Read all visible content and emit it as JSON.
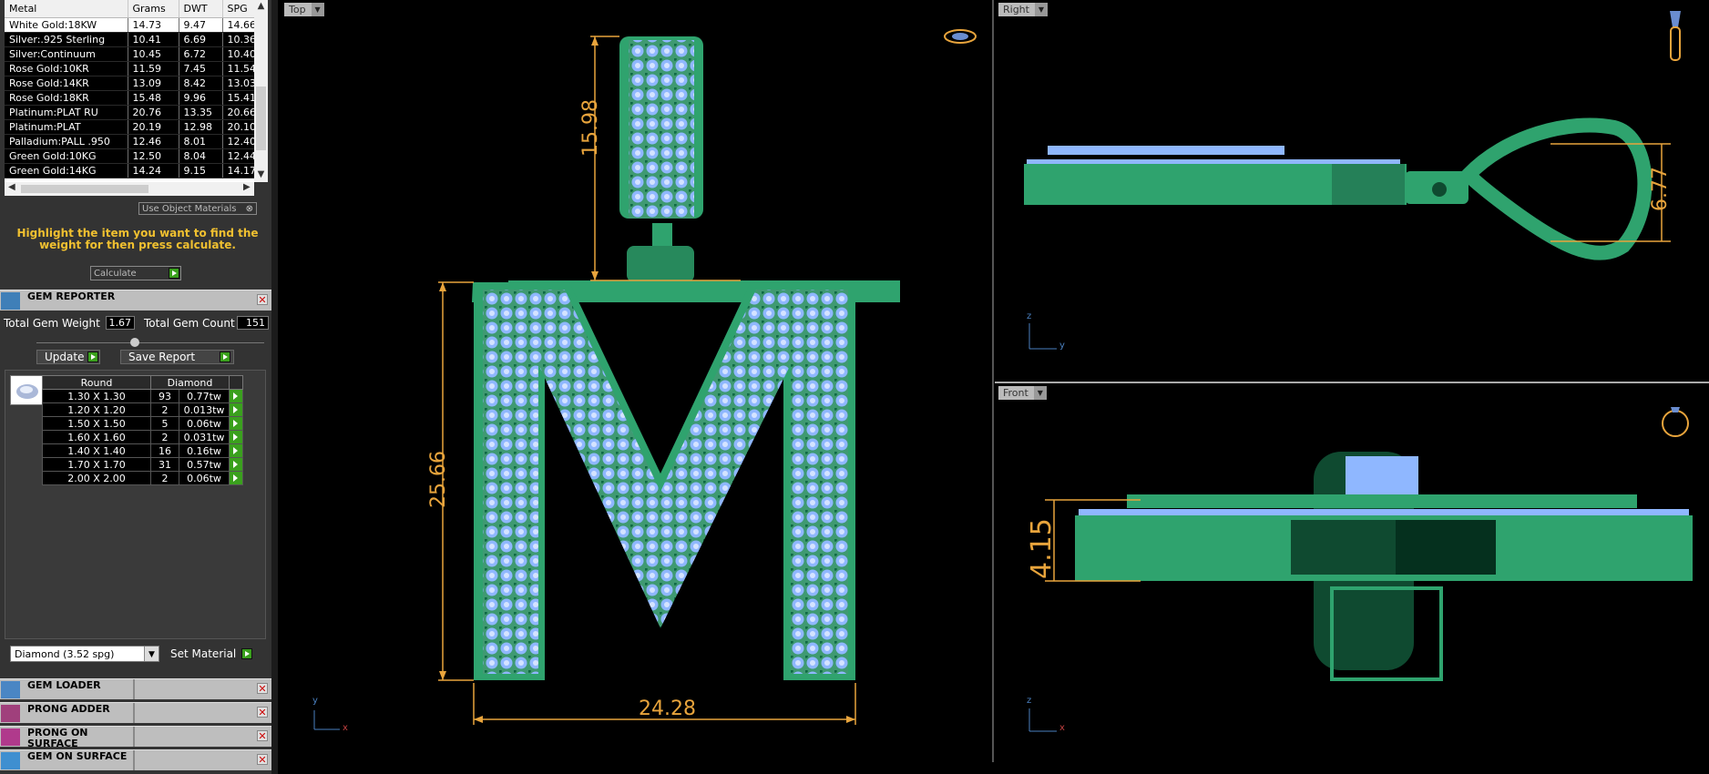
{
  "metal_table": {
    "columns": [
      "Metal",
      "Grams",
      "DWT",
      "SPG"
    ],
    "rows": [
      [
        "White Gold:18KW",
        "14.73",
        "9.47",
        "14.66"
      ],
      [
        "Silver:.925 Sterling",
        "10.41",
        "6.69",
        "10.36"
      ],
      [
        "Silver:Continuum",
        "10.45",
        "6.72",
        "10.40"
      ],
      [
        "Rose Gold:10KR",
        "11.59",
        "7.45",
        "11.54"
      ],
      [
        "Rose Gold:14KR",
        "13.09",
        "8.42",
        "13.03"
      ],
      [
        "Rose Gold:18KR",
        "15.48",
        "9.96",
        "15.41"
      ],
      [
        "Platinum:PLAT RU",
        "20.76",
        "13.35",
        "20.66"
      ],
      [
        "Platinum:PLAT",
        "20.19",
        "12.98",
        "20.10"
      ],
      [
        "Palladium:PALL .950",
        "12.46",
        "8.01",
        "12.40"
      ],
      [
        "Green Gold:10KG",
        "12.50",
        "8.04",
        "12.44"
      ],
      [
        "Green Gold:14KG",
        "14.24",
        "9.15",
        "14.17"
      ]
    ]
  },
  "use_object_materials": "Use Object Materials",
  "hint": "Highlight the item you want to find the weight for then press calculate.",
  "calculate_label": "Calculate",
  "gem_reporter": {
    "title": "GEM REPORTER",
    "total_weight_label": "Total Gem Weight",
    "total_weight": "1.67",
    "total_count_label": "Total Gem Count",
    "total_count": "151",
    "update_label": "Update",
    "save_label": "Save Report",
    "table_headers": [
      "Round",
      "Diamond"
    ],
    "rows": [
      [
        "1.30 X 1.30",
        "93",
        "0.77tw"
      ],
      [
        "1.20 X 1.20",
        "2",
        "0.013tw"
      ],
      [
        "1.50 X 1.50",
        "5",
        "0.06tw"
      ],
      [
        "1.60 X 1.60",
        "2",
        "0.031tw"
      ],
      [
        "1.40 X 1.40",
        "16",
        "0.16tw"
      ],
      [
        "1.70 X 1.70",
        "31",
        "0.57tw"
      ],
      [
        "2.00 X 2.00",
        "2",
        "0.06tw"
      ]
    ],
    "material_select": "Diamond    (3.52 spg)",
    "set_material_label": "Set Material"
  },
  "panels": [
    {
      "title": "GEM LOADER",
      "icon": "gem-loader-icon"
    },
    {
      "title": "PRONG ADDER",
      "icon": "prong-adder-icon"
    },
    {
      "title": "PRONG ON SURFACE",
      "icon": "prong-on-surface-icon"
    },
    {
      "title": "GEM ON SURFACE",
      "icon": "gem-on-surface-icon"
    }
  ],
  "viewports": {
    "top": {
      "label": "Top",
      "axis_v": "y",
      "axis_h": "x",
      "dims": [
        "15.98",
        "25.66",
        "24.28"
      ]
    },
    "right": {
      "label": "Right",
      "axis_v": "z",
      "axis_h": "y",
      "dims": [
        "6.77"
      ]
    },
    "front": {
      "label": "Front",
      "axis_v": "z",
      "axis_h": "x",
      "dims": [
        "4.15"
      ]
    }
  },
  "colors": {
    "metal": "#2fa36e",
    "gem": "#8fb7ff",
    "dim": "#e8a43c",
    "hint": "#f0c030",
    "accent": "#3aa01d"
  }
}
